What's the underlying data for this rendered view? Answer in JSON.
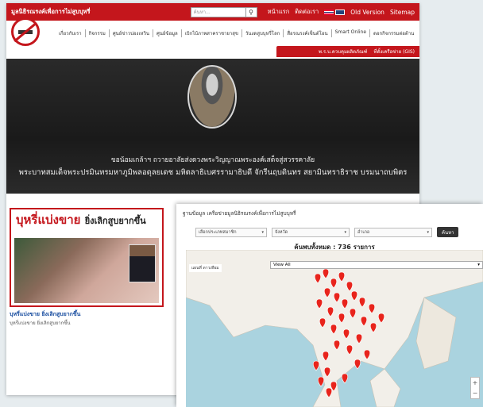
{
  "site": {
    "brand": "มูลนิธิรณรงค์เพื่อการไม่สูบบุหรี่",
    "search_placeholder": "ค้นหา...",
    "top_links": [
      "หน้าแรก",
      "ติดต่อเรา",
      "Old Version",
      "Sitemap"
    ],
    "menu": [
      "เกี่ยวกับเรา",
      "กิจกรรม",
      "ศูนย์ข่าวบ่องเหวิน",
      "ศูนย์ข้อมูล",
      "เบิกไบ้ภาพสาคราชายาสุข",
      "วันงดสูบบุหรี่โลก",
      "สื่อรณรงค์เซ็นต์โอน",
      "Smart Online",
      "ดอกกิจกรรมต่อต้าน"
    ],
    "subbar": [
      "พ.ร.บ.ควบคุมผลิตภัณฑ์",
      "ที่ตั้งเครือข่าย (GIS)"
    ],
    "banner_line1": "ขอน้อมเกล้าฯ ถวายอาลัยส่งดวงพระวิญญาณพระองค์เสด็จสู่สวรรคาลัย",
    "banner_line2": "พระบาทสมเด็จพระปรมินทรมหาภูมิพลอดุลยเดช มหิตลาธิเบศรรามาธิบดี จักรีนฤบดินทร สยามินทราธิราช บรมนาถบพิตร",
    "card": {
      "title": "บุหรี่แบ่งขาย",
      "title_sub": "ยิ่งเลิกสูบยากขึ้น",
      "caption": "บุหรี่แบ่งขาย ยิ่งเลิกสูบยากขึ้น",
      "sub": "บุหรี่แบ่งขาย ยิ่งเลิกสูบยากขึ้น"
    }
  },
  "panel": {
    "title": "ฐานข้อมูล เครือข่ายมูลนิธิรณรงค์เพื่อการไม่สูบบุหรี่",
    "filters": [
      "เลือกประเภทสมาชิก",
      "จังหวัด",
      "อำเภอ"
    ],
    "go_label": "ค้นหา",
    "count_label": "ค้นพบทั้งหมด : 736 รายการ",
    "map_type": "แผนที่",
    "map_type_alt": "ดาวเทียม",
    "view_all": "View All",
    "zoom_in": "+",
    "zoom_out": "−",
    "pin_color": "#e8241c"
  },
  "colors": {
    "brand_red": "#c4161c",
    "water": "#aad3df",
    "land": "#f2efe9"
  }
}
